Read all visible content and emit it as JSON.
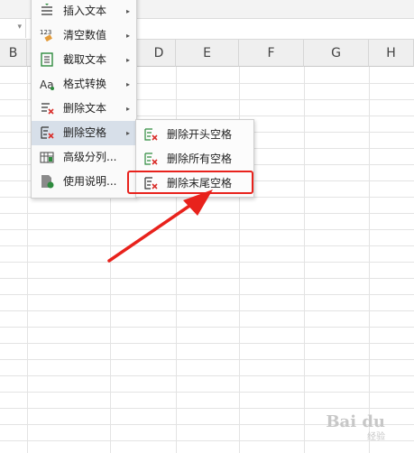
{
  "sheet": {
    "columns": [
      "B",
      "D",
      "E",
      "F",
      "G",
      "H"
    ]
  },
  "menu": {
    "items": [
      {
        "label": "插入文本",
        "icon": "insert-text-icon",
        "submenu": true
      },
      {
        "label": "清空数值",
        "icon": "clear-values-icon",
        "submenu": true
      },
      {
        "label": "截取文本",
        "icon": "extract-text-icon",
        "submenu": true
      },
      {
        "label": "格式转换",
        "icon": "format-convert-icon",
        "submenu": true
      },
      {
        "label": "删除文本",
        "icon": "delete-text-icon",
        "submenu": true
      },
      {
        "label": "删除空格",
        "icon": "delete-spaces-icon",
        "submenu": true
      },
      {
        "label": "高级分列...",
        "icon": "advanced-split-icon",
        "submenu": false
      },
      {
        "label": "使用说明...",
        "icon": "help-doc-icon",
        "submenu": false
      }
    ],
    "icon_123": "123",
    "chevron": "▸",
    "aa": "Aa"
  },
  "submenu": {
    "items": [
      {
        "label": "删除开头空格"
      },
      {
        "label": "删除所有空格"
      },
      {
        "label": "删除末尾空格"
      }
    ]
  },
  "annotation": {
    "color": "#e8221c"
  },
  "watermark": {
    "text": "Bai du",
    "sub": "经验"
  }
}
